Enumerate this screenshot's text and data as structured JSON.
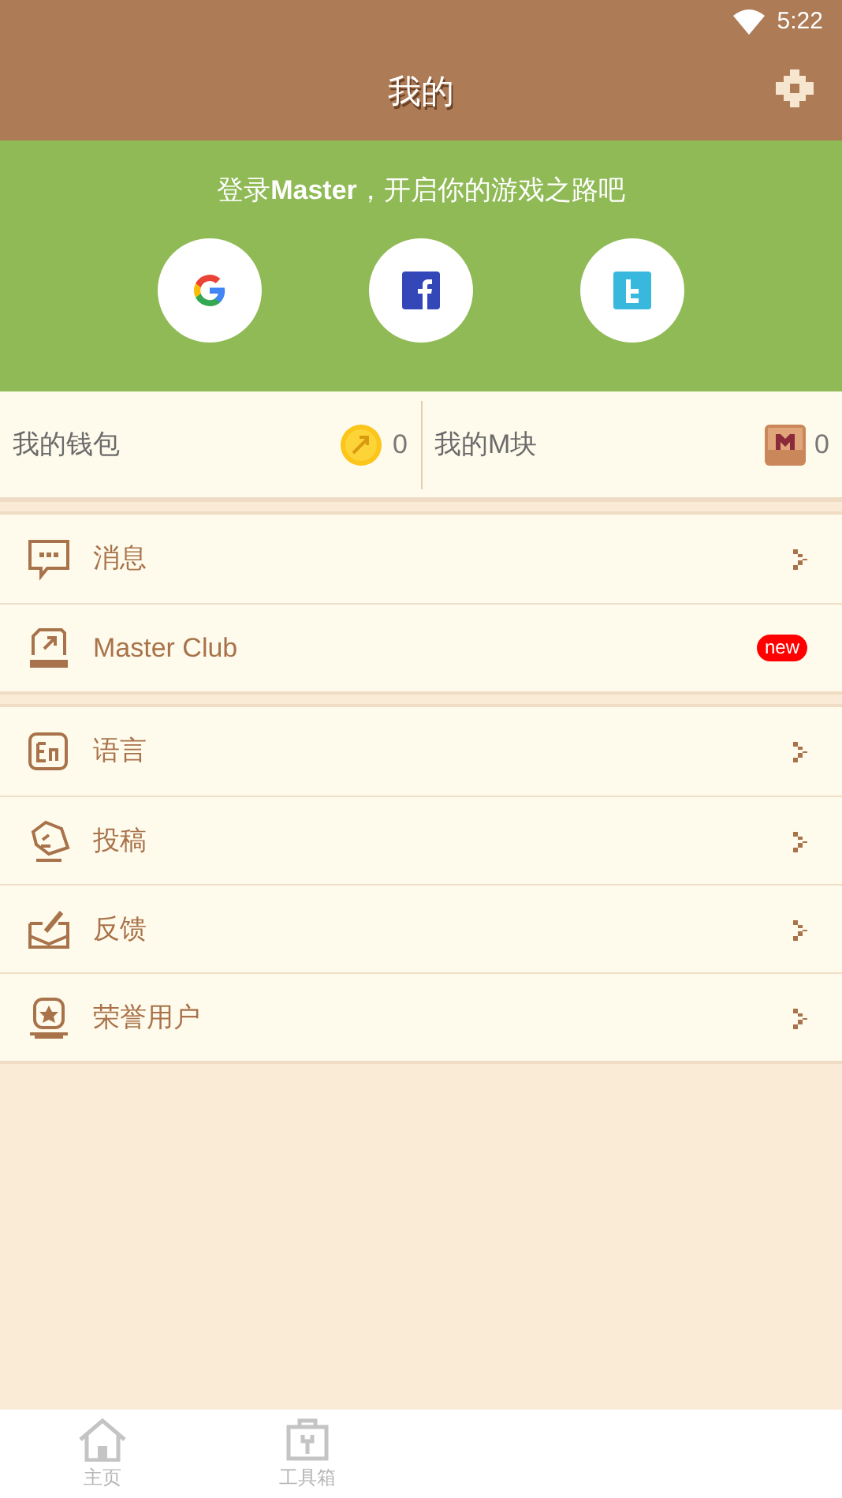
{
  "status_bar": {
    "time": "5:22"
  },
  "header": {
    "title": "我的"
  },
  "login": {
    "prompt": "登录**Master**，开启你的游戏之路吧",
    "providers": [
      {
        "kind": "google"
      },
      {
        "kind": "facebook"
      },
      {
        "kind": "twitter"
      }
    ]
  },
  "wallet": [
    {
      "kind": "coin",
      "label": "我的钱包",
      "value": "0"
    },
    {
      "kind": "block",
      "label": "我的M块",
      "value": "0"
    }
  ],
  "menu_groups": [
    [
      {
        "kind": "message",
        "label": "消息"
      },
      {
        "kind": "club",
        "label": "Master Club",
        "badge": "new"
      }
    ],
    [
      {
        "kind": "language",
        "label": "语言"
      },
      {
        "kind": "submit",
        "label": "投稿"
      },
      {
        "kind": "feedback",
        "label": "反馈"
      },
      {
        "kind": "honor",
        "label": "荣誉用户"
      }
    ]
  ],
  "bottom_nav": [
    {
      "kind": "home",
      "label": "主页",
      "selected": false
    },
    {
      "kind": "toolbox",
      "label": "工具箱",
      "selected": false
    }
  ]
}
